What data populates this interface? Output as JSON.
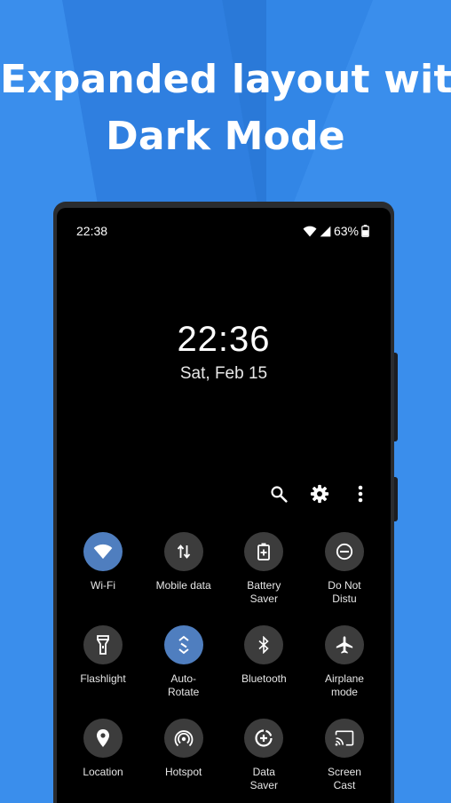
{
  "promo": {
    "headline_line1": "Expanded layout with",
    "headline_line2": "Dark Mode"
  },
  "status_bar": {
    "time": "22:38",
    "battery": "63%"
  },
  "lockscreen": {
    "time": "22:36",
    "date": "Sat, Feb 15"
  },
  "toolbar": {
    "icons": [
      "search-icon",
      "gear-icon",
      "more-vert-icon"
    ]
  },
  "tiles": [
    {
      "label": "Wi-Fi",
      "icon": "wifi-icon",
      "active": true
    },
    {
      "label": "Mobile data",
      "icon": "mobile-data-icon",
      "active": false
    },
    {
      "label": "Battery\nSaver",
      "icon": "battery-saver-icon",
      "active": false
    },
    {
      "label": "Do Not\nDistu",
      "icon": "do-not-disturb-icon",
      "active": false
    },
    {
      "label": "Flashlight",
      "icon": "flashlight-icon",
      "active": false
    },
    {
      "label": "Auto-\nRotate",
      "icon": "auto-rotate-icon",
      "active": true
    },
    {
      "label": "Bluetooth",
      "icon": "bluetooth-icon",
      "active": false
    },
    {
      "label": "Airplane\nmode",
      "icon": "airplane-icon",
      "active": false
    },
    {
      "label": "Location",
      "icon": "location-icon",
      "active": false
    },
    {
      "label": "Hotspot",
      "icon": "hotspot-icon",
      "active": false
    },
    {
      "label": "Data\nSaver",
      "icon": "data-saver-icon",
      "active": false
    },
    {
      "label": "Screen\nCast",
      "icon": "screen-cast-icon",
      "active": false
    }
  ],
  "colors": {
    "background": "#3a8eec",
    "tile_active": "#4f7ebf",
    "tile_inactive": "#3c3c3c"
  }
}
